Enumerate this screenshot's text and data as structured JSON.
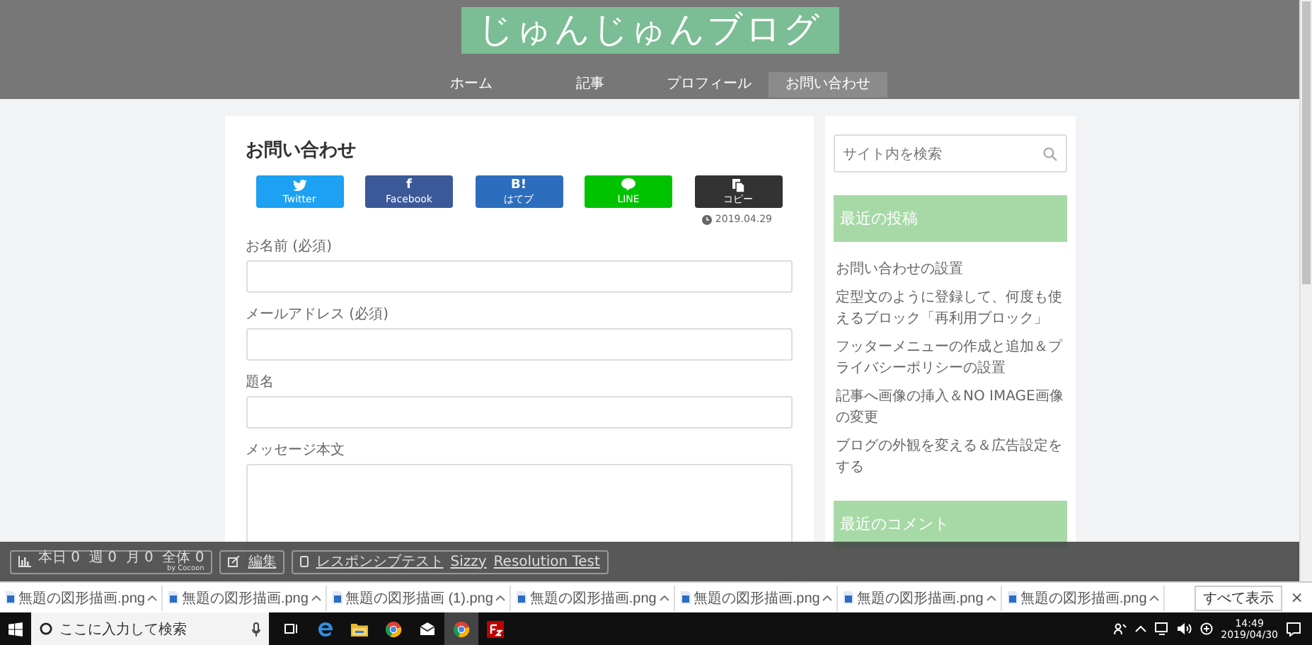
{
  "site": {
    "title": "じゅんじゅんブログ"
  },
  "nav": [
    {
      "label": "ホーム",
      "selected": false
    },
    {
      "label": "記事",
      "selected": false
    },
    {
      "label": "プロフィール",
      "selected": false
    },
    {
      "label": "お問い合わせ",
      "selected": true
    }
  ],
  "article": {
    "title": "お問い合わせ",
    "share_buttons": [
      {
        "kind": "twitter",
        "label": "Twitter"
      },
      {
        "kind": "facebook",
        "icon": "f",
        "label": "Facebook"
      },
      {
        "kind": "hatena",
        "icon": "B!",
        "label": "はてブ"
      },
      {
        "kind": "line",
        "label": "LINE"
      },
      {
        "kind": "copy",
        "label": "コピー"
      }
    ],
    "date": "2019.04.29",
    "fields": [
      {
        "kind": "input",
        "label": "お名前 (必須)"
      },
      {
        "kind": "input",
        "label": "メールアドレス (必須)"
      },
      {
        "kind": "input",
        "label": "題名"
      },
      {
        "kind": "textarea",
        "label": "メッセージ本文"
      }
    ]
  },
  "sidebar": {
    "search": {
      "placeholder": "サイト内を検索"
    },
    "widgets": [
      {
        "title": "最近の投稿",
        "items": [
          "お問い合わせの設置",
          "定型文のように登録して、何度も使えるブロック「再利用ブロック」",
          "フッターメニューの作成と追加＆プライバシーポリシーの設置",
          "記事へ画像の挿入＆NO IMAGE画像の変更",
          "ブログの外観を変える＆広告設定をする"
        ]
      },
      {
        "title": "最近のコメント"
      }
    ]
  },
  "admin_bar": {
    "counter": "本日 0  週 0  月 0  全体 0",
    "credit": "by Cocoon",
    "edit": "編集",
    "links": [
      "レスポンシブテスト",
      "Sizzy",
      "Resolution Test"
    ]
  },
  "downloads": {
    "items": [
      "無題の図形描画.png",
      "無題の図形描画.png",
      "無題の図形描画 (1).png",
      "無題の図形描画.png",
      "無題の図形描画.png",
      "無題の図形描画.png",
      "無題の図形描画.png"
    ],
    "show_all": "すべて表示",
    "close": "×"
  },
  "taskbar": {
    "search_placeholder": "ここに入力して検索",
    "apps": [
      {
        "kind": "taskview",
        "selected": false
      },
      {
        "kind": "edge",
        "selected": false
      },
      {
        "kind": "folder",
        "selected": false
      },
      {
        "kind": "chrome",
        "selected": false
      },
      {
        "kind": "mail",
        "selected": false
      },
      {
        "kind": "chrome",
        "selected": true
      },
      {
        "kind": "filezilla",
        "selected": false
      }
    ],
    "time": "14:49",
    "date": "2019/04/30"
  }
}
